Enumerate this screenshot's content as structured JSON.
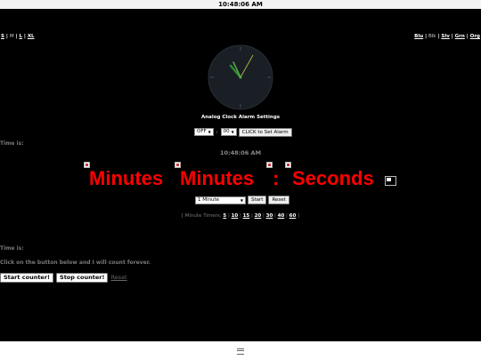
{
  "status_bar": {
    "time": "10:48:06 AM"
  },
  "size_links": {
    "items": [
      "S",
      "M",
      "L",
      "XL"
    ],
    "separator": "|"
  },
  "color_links": {
    "items": [
      "Blu",
      "Blk",
      "Slv",
      "Grn",
      "Org"
    ],
    "separator": "|"
  },
  "clock": {
    "face_color": "#1a1f26",
    "hour_hand_color": "#2e8b2e",
    "minute_hand_color": "#5aa84a",
    "second_hand_color": "#b9c43a"
  },
  "alarm": {
    "title": "Analog Clock Alarm Settings",
    "on_off_value": "OFF",
    "minute_value": "00",
    "colon": ":",
    "set_button": "CLICK to Set Alarm"
  },
  "time_label_1": "Time is:",
  "current_time": "10:48:06 AM",
  "big_display": {
    "part1": "Minutes",
    "part2": "Minutes",
    "colon": ":",
    "part3": "Seconds",
    "color": "#ff0000"
  },
  "timer": {
    "select_value": "1 Minute",
    "start_button": "Start",
    "reset_button": "Reset"
  },
  "minute_timers": {
    "prefix": "[ Minute Timers:",
    "items": [
      "5",
      "10",
      "15",
      "20",
      "30",
      "40",
      "60"
    ],
    "suffix": "]"
  },
  "time_label_2": "Time is:",
  "counter": {
    "instruction": "Click on the button below and I will count forever.",
    "start_button": "Start counter!",
    "stop_button": "Stop counter!",
    "reset_link": "Reset"
  }
}
